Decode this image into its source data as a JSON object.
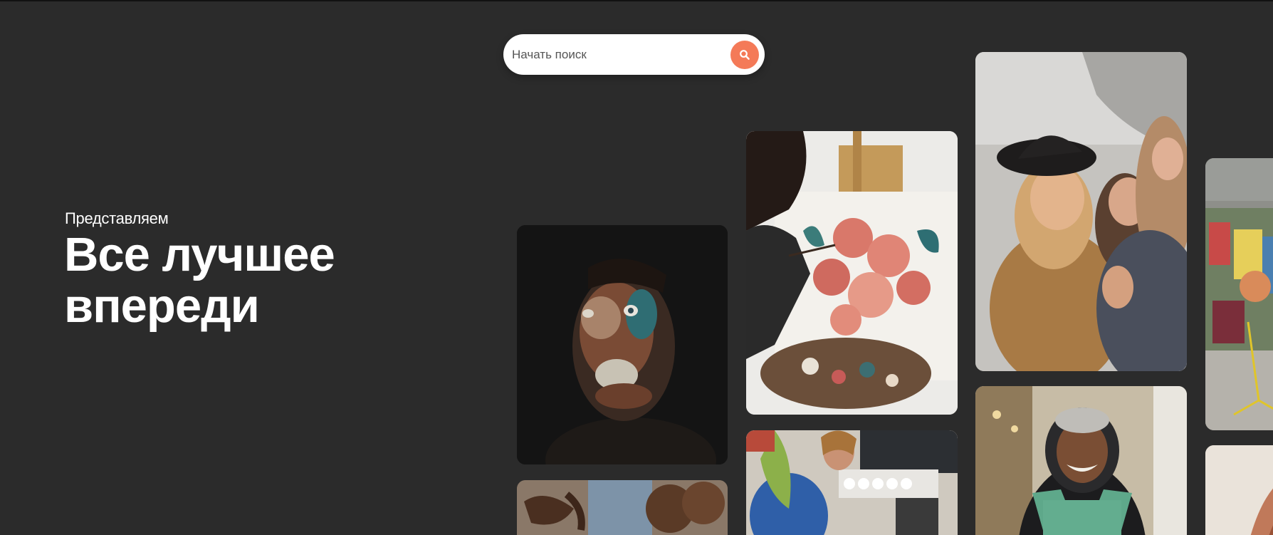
{
  "search": {
    "placeholder": "Начать поиск"
  },
  "hero": {
    "subtitle": "Представляем",
    "title": "Все лучшее впереди"
  },
  "icons": {
    "search_button": "search-icon"
  },
  "colors": {
    "background": "#2b2b2b",
    "accent": "#f47a58",
    "text": "#ffffff"
  },
  "photos": [
    "face-paint-portrait",
    "yarn-knitting",
    "painting-flowers",
    "barista-cafe",
    "friends-laughing",
    "smiling-volunteer",
    "graffiti-wall",
    "partial-photo"
  ]
}
